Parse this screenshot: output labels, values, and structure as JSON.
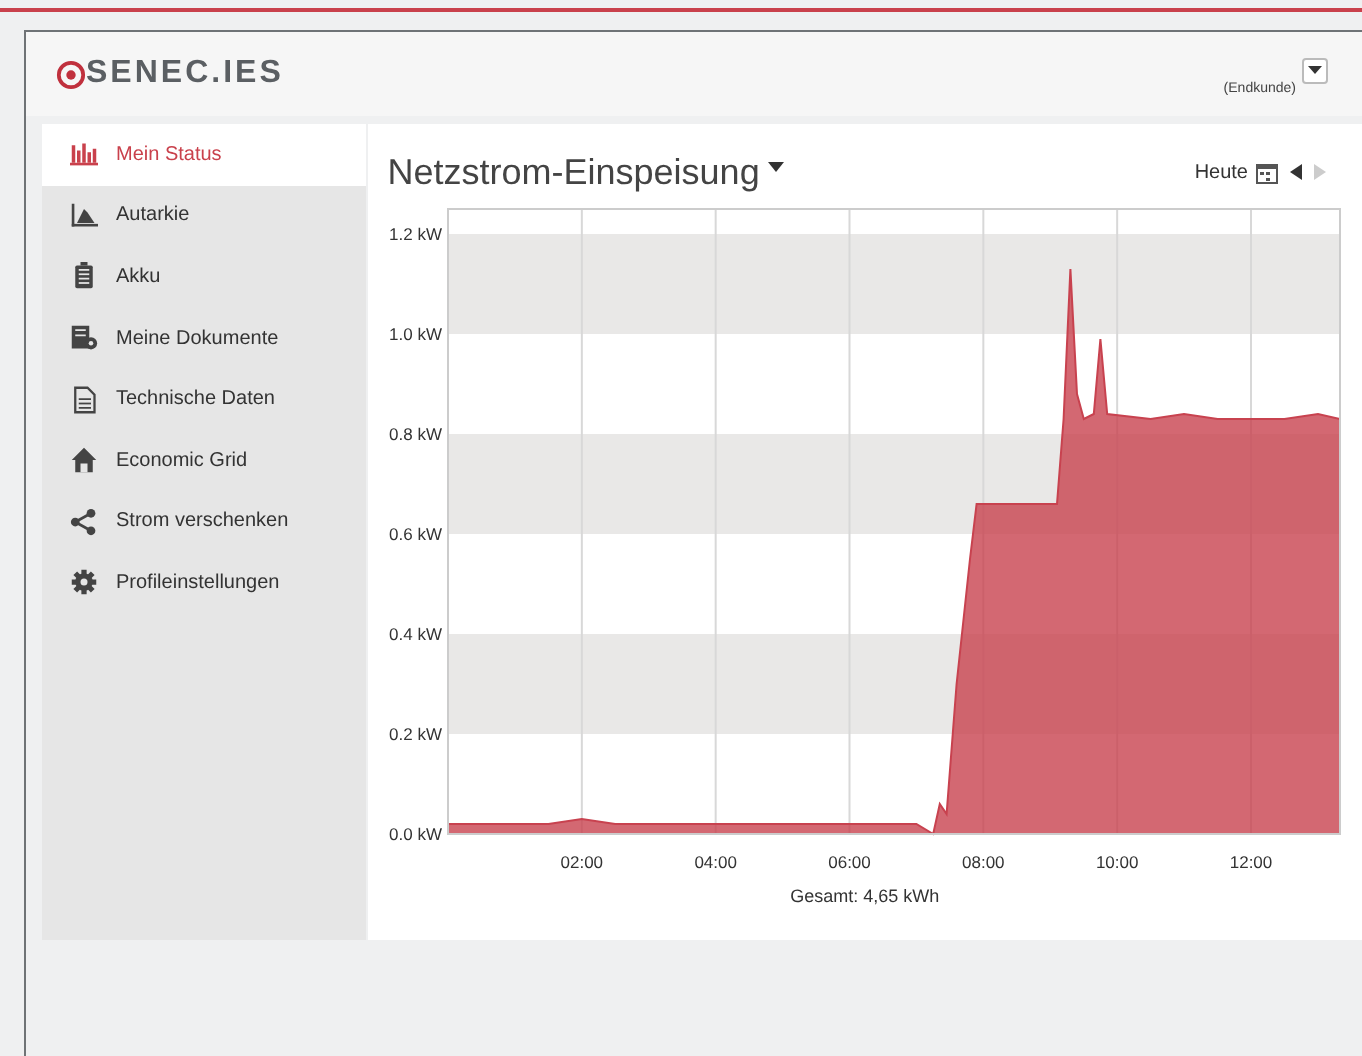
{
  "header": {
    "logo": "SENEC.IES",
    "role": "(Endkunde)"
  },
  "sidebar": {
    "items": [
      {
        "label": "Mein Status",
        "selected": true
      },
      {
        "label": "Autarkie",
        "selected": false
      },
      {
        "label": "Akku",
        "selected": false
      },
      {
        "label": "Meine Dokumente",
        "selected": false
      },
      {
        "label": "Technische Daten",
        "selected": false
      },
      {
        "label": "Economic Grid",
        "selected": false
      },
      {
        "label": "Strom verschenken",
        "selected": false
      },
      {
        "label": "Profileinstellungen",
        "selected": false
      }
    ]
  },
  "panel": {
    "title": "Netzstrom-Einspeisung",
    "period": "Heute",
    "prev": {
      "disabled": false
    },
    "next": {
      "disabled": true
    },
    "total": "Gesamt: 4,65 kWh",
    "chart_data": {
      "type": "area",
      "grid": true,
      "xlim": [
        0,
        13.33
      ],
      "ylim": [
        0,
        1.25
      ],
      "xticks": [
        {
          "value": 2,
          "label": "02:00"
        },
        {
          "value": 4,
          "label": "04:00"
        },
        {
          "value": 6,
          "label": "06:00"
        },
        {
          "value": 8,
          "label": "08:00"
        },
        {
          "value": 10,
          "label": "10:00"
        },
        {
          "value": 12,
          "label": "12:00"
        }
      ],
      "yticks": [
        {
          "value": 0,
          "label": "0.0 kW"
        },
        {
          "value": 0.2,
          "label": "0.2 kW"
        },
        {
          "value": 0.4,
          "label": "0.4 kW"
        },
        {
          "value": 0.6,
          "label": "0.6 kW"
        },
        {
          "value": 0.8,
          "label": "0.8 kW"
        },
        {
          "value": 1.0,
          "label": "1.0 kW"
        },
        {
          "value": 1.2,
          "label": "1.2 kW"
        }
      ],
      "x": [
        0,
        0.5,
        1,
        1.5,
        2,
        2.5,
        3,
        3.5,
        4,
        4.5,
        5,
        5.5,
        6,
        6.5,
        7,
        7.25,
        7.35,
        7.45,
        7.6,
        7.8,
        7.9,
        8.5,
        9.1,
        9.2,
        9.3,
        9.4,
        9.5,
        9.65,
        9.75,
        9.85,
        10.5,
        11,
        11.5,
        12,
        12.5,
        13,
        13.33
      ],
      "series": [
        {
          "color": "#c8424f",
          "values": [
            0.02,
            0.02,
            0.02,
            0.02,
            0.03,
            0.02,
            0.02,
            0.02,
            0.02,
            0.02,
            0.02,
            0.02,
            0.02,
            0.02,
            0.02,
            0.0,
            0.06,
            0.04,
            0.3,
            0.55,
            0.66,
            0.66,
            0.66,
            0.83,
            1.13,
            0.88,
            0.83,
            0.84,
            0.99,
            0.84,
            0.83,
            0.84,
            0.83,
            0.83,
            0.83,
            0.84,
            0.83
          ]
        }
      ]
    }
  }
}
